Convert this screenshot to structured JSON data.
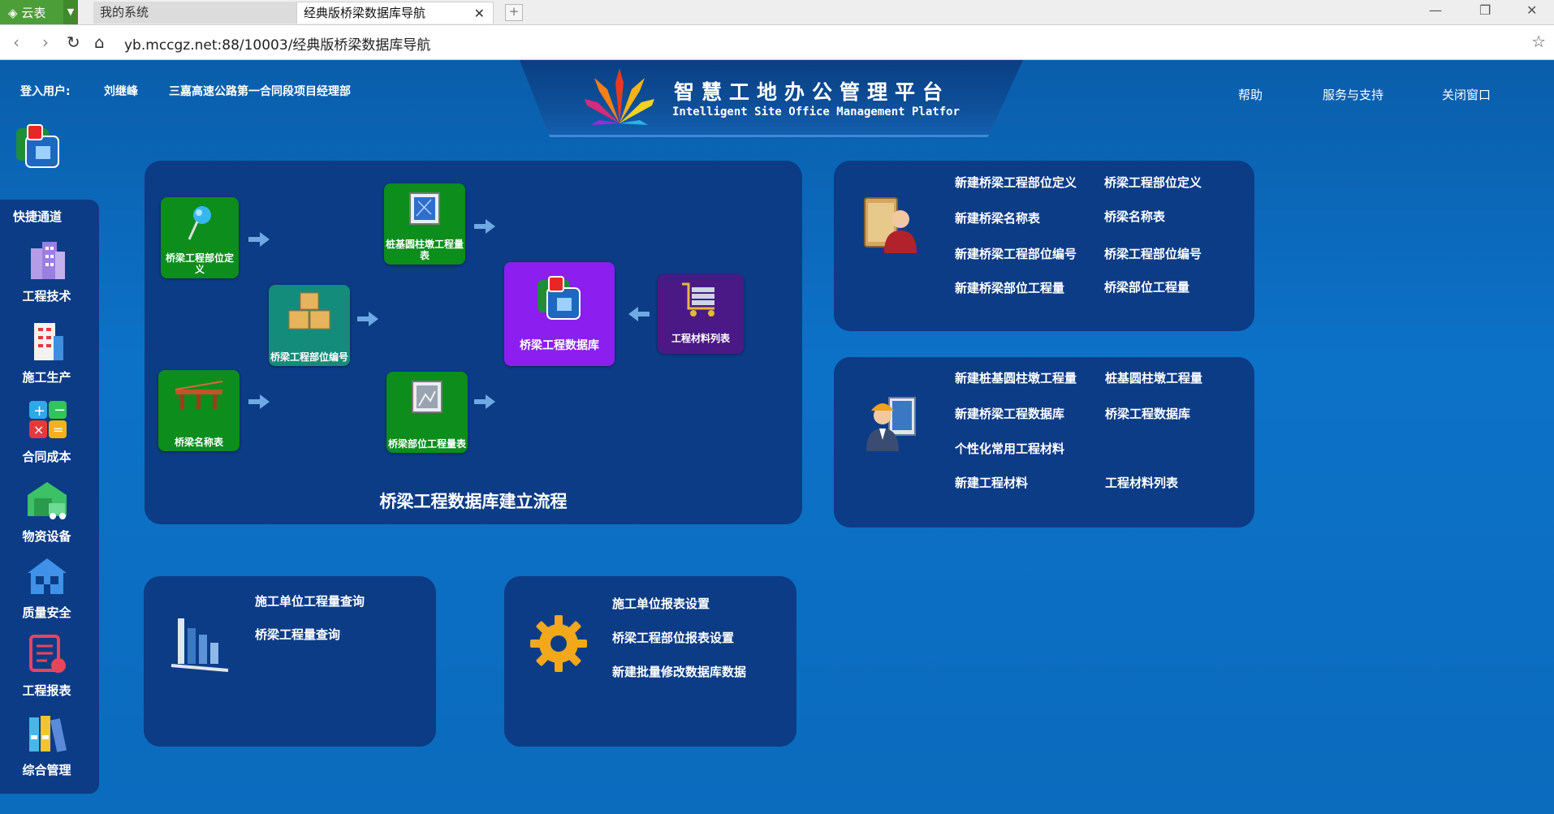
{
  "browser": {
    "app_button": "云表",
    "tabs": [
      {
        "label": "我的系统"
      },
      {
        "label": "经典版桥梁数据库导航"
      }
    ],
    "url": "yb.mccgz.net:88/10003/经典版桥梁数据库导航"
  },
  "header": {
    "user_label": "登入用户:",
    "user_name": "刘继峰",
    "department": "三嘉高速公路第一合同段项目经理部",
    "title": "智慧工地办公管理平台",
    "subtitle": "Intelligent Site Office Management Platfor",
    "links": [
      "帮助",
      "服务与支持",
      "关闭窗口"
    ]
  },
  "sidebar": {
    "title": "快捷通道",
    "items": [
      {
        "label": "工程技术",
        "icon": "buildings-icon"
      },
      {
        "label": "施工生产",
        "icon": "building-icon"
      },
      {
        "label": "合同成本",
        "icon": "calculator-icon"
      },
      {
        "label": "物资设备",
        "icon": "warehouse-truck-icon"
      },
      {
        "label": "质量安全",
        "icon": "house-icon"
      },
      {
        "label": "工程报表",
        "icon": "report-icon"
      },
      {
        "label": "综合管理",
        "icon": "binders-icon"
      }
    ]
  },
  "flow": {
    "title": "桥梁工程数据库建立流程",
    "tiles": {
      "part_def": "桥梁工程部位定义",
      "bridge_names": "桥梁名称表",
      "part_code": "桥梁工程部位编号",
      "pile_qty": "桩基圆柱墩工程量表",
      "part_qty": "桥梁部位工程量表",
      "database": "桥梁工程数据库",
      "materials": "工程材料列表"
    }
  },
  "panel1": {
    "links_left": [
      "新建桥梁工程部位定义",
      "新建桥梁名称表",
      "新建桥梁工程部位编号",
      "新建桥梁部位工程量"
    ],
    "links_right": [
      "桥梁工程部位定义",
      "桥梁名称表",
      "桥梁工程部位编号",
      "桥梁部位工程量"
    ]
  },
  "panel2": {
    "links_left": [
      "新建桩基圆柱墩工程量",
      "新建桥梁工程数据库",
      "个性化常用工程材料",
      "新建工程材料"
    ],
    "links_right": [
      "桩基圆柱墩工程量",
      "桥梁工程数据库",
      "工程材料列表"
    ]
  },
  "panel3": {
    "links": [
      "施工单位工程量查询",
      "桥梁工程量查询"
    ]
  },
  "panel4": {
    "links": [
      "施工单位报表设置",
      "桥梁工程部位报表设置",
      "新建批量修改数据库数据"
    ]
  }
}
